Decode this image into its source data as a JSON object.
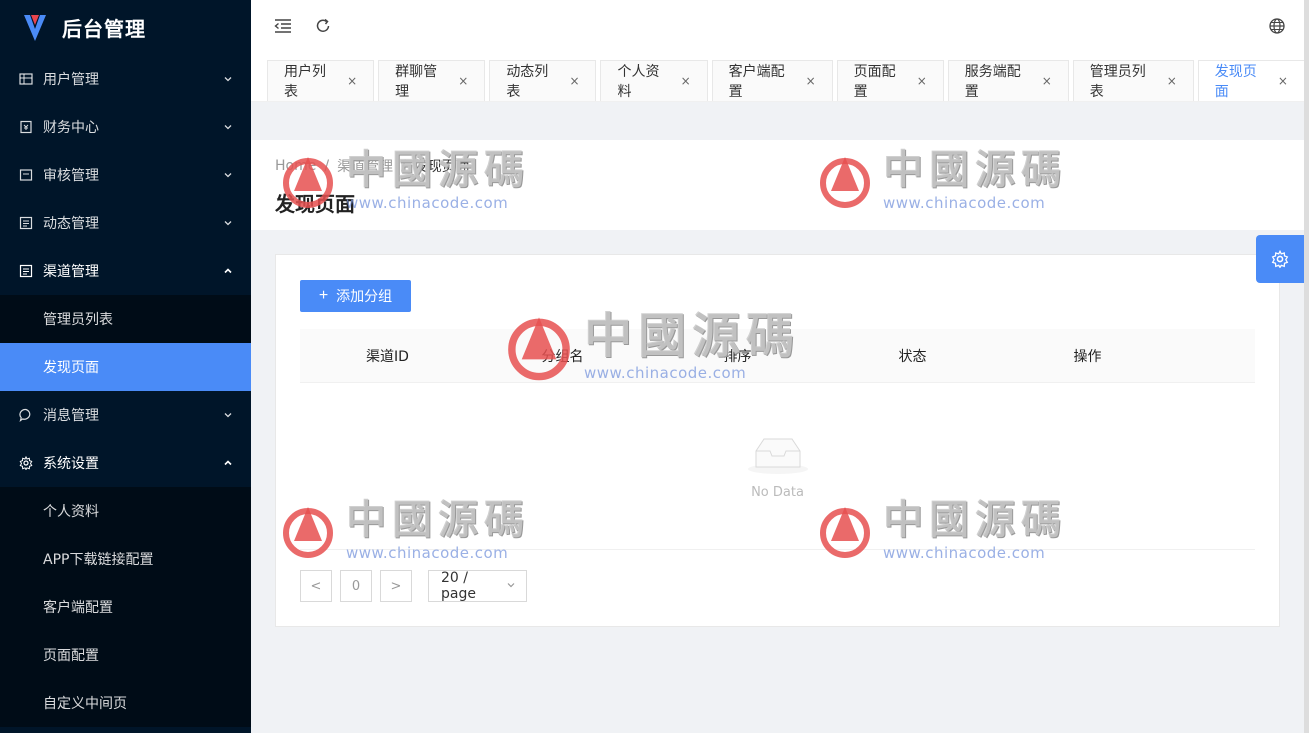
{
  "app": {
    "title": "后台管理"
  },
  "sidebar": {
    "items": [
      {
        "label": "用户管理",
        "icon": "table-icon",
        "open": false
      },
      {
        "label": "财务中心",
        "icon": "receipt-icon",
        "open": false
      },
      {
        "label": "审核管理",
        "icon": "audit-icon",
        "open": false
      },
      {
        "label": "动态管理",
        "icon": "list-icon",
        "open": false
      },
      {
        "label": "渠道管理",
        "icon": "list-icon",
        "open": true,
        "children": [
          "管理员列表",
          "发现页面"
        ]
      },
      {
        "label": "消息管理",
        "icon": "message-icon",
        "open": false
      },
      {
        "label": "系统设置",
        "icon": "gear-icon",
        "open": true,
        "children": [
          "个人资料",
          "APP下载链接配置",
          "客户端配置",
          "页面配置",
          "自定义中间页"
        ]
      }
    ],
    "active_sub": "发现页面"
  },
  "tabs": [
    {
      "label": "用户列表"
    },
    {
      "label": "群聊管理"
    },
    {
      "label": "动态列表"
    },
    {
      "label": "个人资料"
    },
    {
      "label": "客户端配置"
    },
    {
      "label": "页面配置"
    },
    {
      "label": "服务端配置"
    },
    {
      "label": "管理员列表"
    },
    {
      "label": "发现页面",
      "active": true
    }
  ],
  "tab_close": "×",
  "breadcrumb": {
    "home": "Home",
    "parent": "渠道管理",
    "current": "发现页面",
    "sep": "/"
  },
  "page_title": "发现页面",
  "add_button": {
    "plus": "+",
    "label": "添加分组"
  },
  "table": {
    "headers": [
      "渠道ID",
      "分组名",
      "排序",
      "状态",
      "操作"
    ],
    "empty_text": "No Data"
  },
  "pagination": {
    "prev": "<",
    "page": "0",
    "next": ">",
    "size": "20 / page"
  },
  "watermark": {
    "cn": "中國源碼",
    "url": "www.chinacode.com"
  },
  "colors": {
    "sidebar_bg": "#001529",
    "accent": "#4a8bf7"
  }
}
